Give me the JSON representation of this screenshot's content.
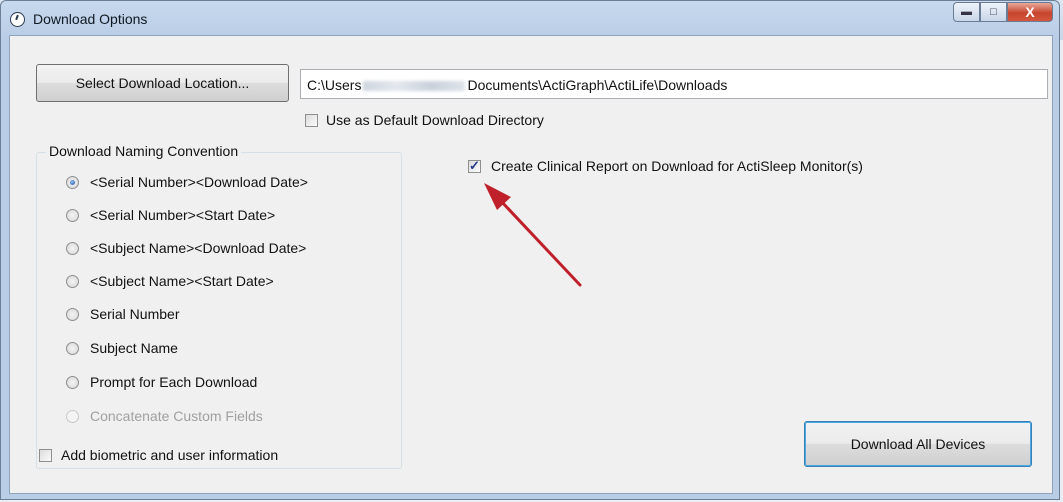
{
  "window": {
    "title": "Download Options"
  },
  "location": {
    "select_button": "Select Download Location...",
    "path_prefix": "C:\\Users",
    "path_suffix": "Documents\\ActiGraph\\ActiLife\\Downloads",
    "default_dir_label": "Use as Default Download Directory",
    "default_dir_checked": false
  },
  "naming": {
    "group_title": "Download Naming Convention",
    "options": [
      {
        "label": "<Serial Number><Download Date>",
        "selected": true,
        "enabled": true
      },
      {
        "label": "<Serial Number><Start Date>",
        "selected": false,
        "enabled": true
      },
      {
        "label": "<Subject Name><Download Date>",
        "selected": false,
        "enabled": true
      },
      {
        "label": "<Subject Name><Start Date>",
        "selected": false,
        "enabled": true
      },
      {
        "label": "Serial Number",
        "selected": false,
        "enabled": true
      },
      {
        "label": "Subject Name",
        "selected": false,
        "enabled": true
      },
      {
        "label": "Prompt for Each Download",
        "selected": false,
        "enabled": true
      },
      {
        "label": "Concatenate Custom Fields",
        "selected": false,
        "enabled": false
      }
    ]
  },
  "clinical_report": {
    "label": "Create Clinical Report on Download for ActiSleep Monitor(s)",
    "checked": true
  },
  "biometric": {
    "label": "Add biometric and user information",
    "checked": false
  },
  "actions": {
    "download_all": "Download All Devices"
  },
  "annotation": {
    "arrow_color": "#c0202a"
  }
}
